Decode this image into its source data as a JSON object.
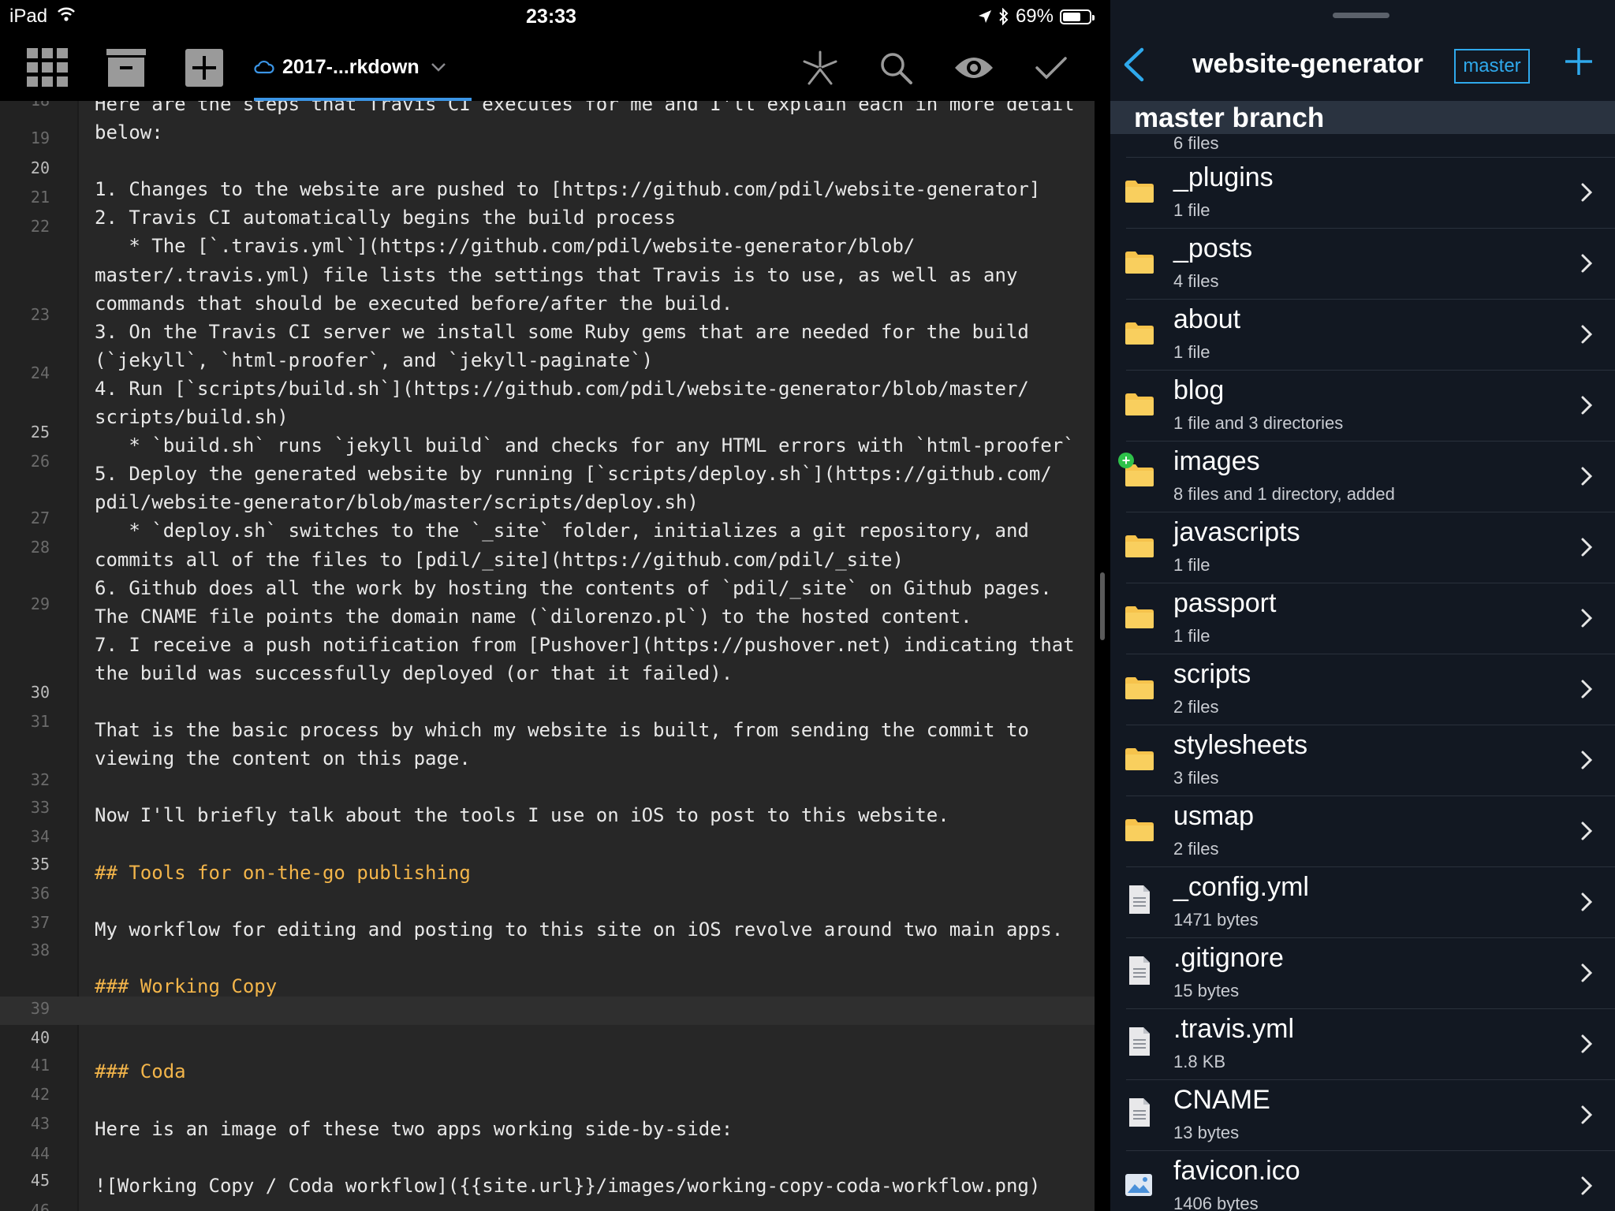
{
  "status_bar": {
    "device": "iPad",
    "time": "23:33",
    "battery": "69%",
    "battery_level": 0.69
  },
  "editor_toolbar": {
    "document_tab": "2017-...rkdown",
    "icons": [
      "grid-icon",
      "archive-icon",
      "plus-square-icon",
      "cloud-icon",
      "chevron-down-icon",
      "asterisk-icon",
      "search-icon",
      "eye-icon",
      "checkmark-icon"
    ]
  },
  "editor": {
    "top_partial_text": "Here are the steps that Travis CI executes for me and I'll explain each in more detail",
    "line_numbers": [
      {
        "n": "18",
        "bright": false
      },
      {
        "n": "19",
        "bright": false
      },
      {
        "n": "20",
        "bright": true
      },
      {
        "n": "21",
        "bright": false
      },
      {
        "n": "22",
        "bright": false
      },
      {
        "n": "23",
        "bright": false
      },
      {
        "n": "24",
        "bright": false
      },
      {
        "n": "25",
        "bright": true
      },
      {
        "n": "26",
        "bright": false
      },
      {
        "n": "27",
        "bright": false
      },
      {
        "n": "28",
        "bright": false
      },
      {
        "n": "29",
        "bright": false
      },
      {
        "n": "30",
        "bright": true
      },
      {
        "n": "31",
        "bright": false
      },
      {
        "n": "32",
        "bright": false
      },
      {
        "n": "33",
        "bright": false
      },
      {
        "n": "34",
        "bright": false
      },
      {
        "n": "35",
        "bright": true
      },
      {
        "n": "36",
        "bright": false
      },
      {
        "n": "37",
        "bright": false
      },
      {
        "n": "38",
        "bright": false
      },
      {
        "n": "39",
        "bright": false
      },
      {
        "n": "40",
        "bright": true
      },
      {
        "n": "41",
        "bright": false
      },
      {
        "n": "42",
        "bright": false
      },
      {
        "n": "43",
        "bright": false
      },
      {
        "n": "44",
        "bright": false
      },
      {
        "n": "45",
        "bright": true
      },
      {
        "n": "46",
        "bright": false
      }
    ],
    "lines": [
      {
        "text": "below:",
        "heading": false
      },
      {
        "text": "",
        "heading": false
      },
      {
        "text": "1. Changes to the website are pushed to [https://github.com/pdil/website-generator]",
        "heading": false
      },
      {
        "text": "2. Travis CI automatically begins the build process",
        "heading": false
      },
      {
        "text": "   * The [`.travis.yml`](https://github.com/pdil/website-generator/blob/",
        "heading": false
      },
      {
        "text": "master/.travis.yml) file lists the settings that Travis is to use, as well as any",
        "heading": false
      },
      {
        "text": "commands that should be executed before/after the build.",
        "heading": false
      },
      {
        "text": "3. On the Travis CI server we install some Ruby gems that are needed for the build",
        "heading": false
      },
      {
        "text": "(`jekyll`, `html-proofer`, and `jekyll-paginate`)",
        "heading": false
      },
      {
        "text": "4. Run [`scripts/build.sh`](https://github.com/pdil/website-generator/blob/master/",
        "heading": false
      },
      {
        "text": "scripts/build.sh)",
        "heading": false
      },
      {
        "text": "   * `build.sh` runs `jekyll build` and checks for any HTML errors with `html-proofer`",
        "heading": false
      },
      {
        "text": "5. Deploy the generated website by running [`scripts/deploy.sh`](https://github.com/",
        "heading": false
      },
      {
        "text": "pdil/website-generator/blob/master/scripts/deploy.sh)",
        "heading": false
      },
      {
        "text": "   * `deploy.sh` switches to the `_site` folder, initializes a git repository, and",
        "heading": false
      },
      {
        "text": "commits all of the files to [pdil/_site](https://github.com/pdil/_site)",
        "heading": false
      },
      {
        "text": "6. Github does all the work by hosting the contents of `pdil/_site` on Github pages.",
        "heading": false
      },
      {
        "text": "The CNAME file points the domain name (`dilorenzo.pl`) to the hosted content.",
        "heading": false
      },
      {
        "text": "7. I receive a push notification from [Pushover](https://pushover.net) indicating that",
        "heading": false
      },
      {
        "text": "the build was successfully deployed (or that it failed).",
        "heading": false
      },
      {
        "text": "",
        "heading": false
      },
      {
        "text": "That is the basic process by which my website is built, from sending the commit to",
        "heading": false
      },
      {
        "text": "viewing the content on this page.",
        "heading": false
      },
      {
        "text": "",
        "heading": false
      },
      {
        "text": "Now I'll briefly talk about the tools I use on iOS to post to this website.",
        "heading": false
      },
      {
        "text": "",
        "heading": false
      },
      {
        "text": "## Tools for on-the-go publishing",
        "heading": true
      },
      {
        "text": "",
        "heading": false
      },
      {
        "text": "My workflow for editing and posting to this site on iOS revolve around two main apps.",
        "heading": false
      },
      {
        "text": "",
        "heading": false
      },
      {
        "text": "### Working Copy",
        "heading": true
      },
      {
        "text": "",
        "heading": false
      },
      {
        "text": "",
        "heading": false
      },
      {
        "text": "### Coda",
        "heading": true
      },
      {
        "text": "",
        "heading": false
      },
      {
        "text": "Here is an image of these two apps working side-by-side:",
        "heading": false
      },
      {
        "text": "",
        "heading": false
      },
      {
        "text": "![Working Copy / Coda workflow]({{site.url}}/images/working-copy-coda-workflow.png)",
        "heading": false
      }
    ]
  },
  "sidebar": {
    "repo_title": "website-generator",
    "branch_badge": "master",
    "section_title": "master branch",
    "pre_row_count": "6 files",
    "items": [
      {
        "name": "_plugins",
        "detail": "1 file",
        "icon": "folder-icon",
        "added": false
      },
      {
        "name": "_posts",
        "detail": "4 files",
        "icon": "folder-icon",
        "added": false
      },
      {
        "name": "about",
        "detail": "1 file",
        "icon": "folder-icon",
        "added": false
      },
      {
        "name": "blog",
        "detail": "1 file and 3 directories",
        "icon": "folder-icon",
        "added": false
      },
      {
        "name": "images",
        "detail": "8 files and 1 directory, added",
        "icon": "folder-icon",
        "added": true
      },
      {
        "name": "javascripts",
        "detail": "1 file",
        "icon": "folder-icon",
        "added": false
      },
      {
        "name": "passport",
        "detail": "1 file",
        "icon": "folder-icon",
        "added": false
      },
      {
        "name": "scripts",
        "detail": "2 files",
        "icon": "folder-icon",
        "added": false
      },
      {
        "name": "stylesheets",
        "detail": "3 files",
        "icon": "folder-icon",
        "added": false
      },
      {
        "name": "usmap",
        "detail": "2 files",
        "icon": "folder-icon",
        "added": false
      },
      {
        "name": "_config.yml",
        "detail": "1471 bytes",
        "icon": "file-icon",
        "added": false
      },
      {
        "name": ".gitignore",
        "detail": "15 bytes",
        "icon": "file-icon",
        "added": false
      },
      {
        "name": ".travis.yml",
        "detail": "1.8 KB",
        "icon": "file-icon",
        "added": false
      },
      {
        "name": "CNAME",
        "detail": "13 bytes",
        "icon": "file-icon",
        "added": false
      },
      {
        "name": "favicon.ico",
        "detail": "1406 bytes",
        "icon": "image-file-icon",
        "added": false
      }
    ]
  },
  "colors": {
    "editor_bg": "#272727",
    "heading": "#f3b54a",
    "accent_blue": "#2fa9ec",
    "folder": "#f6c34c",
    "sidebar_bg": "#121822",
    "section_bg": "#2a3340"
  }
}
